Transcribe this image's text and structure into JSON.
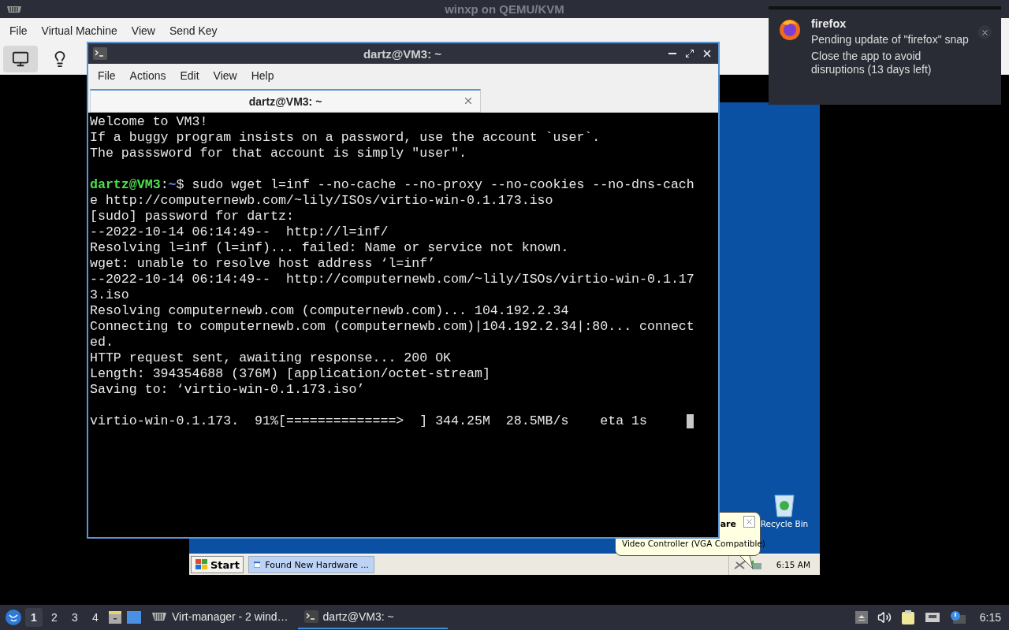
{
  "window": {
    "title": "winxp on QEMU/KVM"
  },
  "menu": [
    "File",
    "Virtual Machine",
    "View",
    "Send Key"
  ],
  "toolbar": [
    {
      "kind": "console",
      "selected": true
    },
    {
      "kind": "details",
      "selected": false
    }
  ],
  "guest": {
    "desktop_icons": [
      {
        "label": "Recycle Bin"
      }
    ],
    "balloon": {
      "title": "are",
      "text": "Video Controller (VGA Compatible)"
    },
    "taskbar": {
      "start": "Start",
      "tasks": [
        {
          "label": "Found New Hardware ...",
          "selected": true
        }
      ],
      "clock": "6:15 AM"
    }
  },
  "terminal": {
    "title": "dartz@VM3: ~",
    "menu": [
      "File",
      "Actions",
      "Edit",
      "View",
      "Help"
    ],
    "tabs": [
      {
        "label": "dartz@VM3: ~",
        "selected": true
      }
    ],
    "lines": [
      {
        "kind": "text",
        "text": "Welcome to VM3!"
      },
      {
        "kind": "text",
        "text": "If a buggy program insists on a password, use the account `user`."
      },
      {
        "kind": "text",
        "text": "The passsword for that account is simply \"user\"."
      },
      {
        "kind": "blank"
      },
      {
        "kind": "prompt",
        "user": "dartz@VM3",
        "sep": ":",
        "path": "~",
        "command": "$ sudo wget l=inf --no-cache --no-proxy --no-cookies --no-dns-cach"
      },
      {
        "kind": "text",
        "text": "e http://computernewb.com/~lily/ISOs/virtio-win-0.1.173.iso"
      },
      {
        "kind": "text",
        "text": "[sudo] password for dartz:"
      },
      {
        "kind": "text",
        "text": "--2022-10-14 06:14:49--  http://l=inf/"
      },
      {
        "kind": "text",
        "text": "Resolving l=inf (l=inf)... failed: Name or service not known."
      },
      {
        "kind": "text",
        "text": "wget: unable to resolve host address ‘l=inf’"
      },
      {
        "kind": "text",
        "text": "--2022-10-14 06:14:49--  http://computernewb.com/~lily/ISOs/virtio-win-0.1.17"
      },
      {
        "kind": "text",
        "text": "3.iso"
      },
      {
        "kind": "text",
        "text": "Resolving computernewb.com (computernewb.com)... 104.192.2.34"
      },
      {
        "kind": "text",
        "text": "Connecting to computernewb.com (computernewb.com)|104.192.2.34|:80... connect"
      },
      {
        "kind": "text",
        "text": "ed."
      },
      {
        "kind": "text",
        "text": "HTTP request sent, awaiting response... 200 OK"
      },
      {
        "kind": "text",
        "text": "Length: 394354688 (376M) [application/octet-stream]"
      },
      {
        "kind": "text",
        "text": "Saving to: ‘virtio-win-0.1.173.iso’"
      },
      {
        "kind": "blank"
      },
      {
        "kind": "progress",
        "text": "virtio-win-0.1.173.  91%[==============>  ] 344.25M  28.5MB/s    eta 1s",
        "cursor": true
      }
    ]
  },
  "notification": {
    "app": "firefox",
    "summary": "Pending update of \"firefox\" snap",
    "body": "Close the app to avoid disruptions (13 days left)"
  },
  "panel": {
    "workspaces": [
      {
        "label": "1",
        "selected": true
      },
      {
        "label": "2",
        "selected": false
      },
      {
        "label": "3",
        "selected": false
      },
      {
        "label": "4",
        "selected": false
      }
    ],
    "tasks": [
      {
        "kind": "virt",
        "label": "Virt-manager - 2 wind…",
        "selected": false
      },
      {
        "kind": "terminal",
        "label": "dartz@VM3: ~",
        "selected": true
      }
    ],
    "clock": "6:15"
  }
}
